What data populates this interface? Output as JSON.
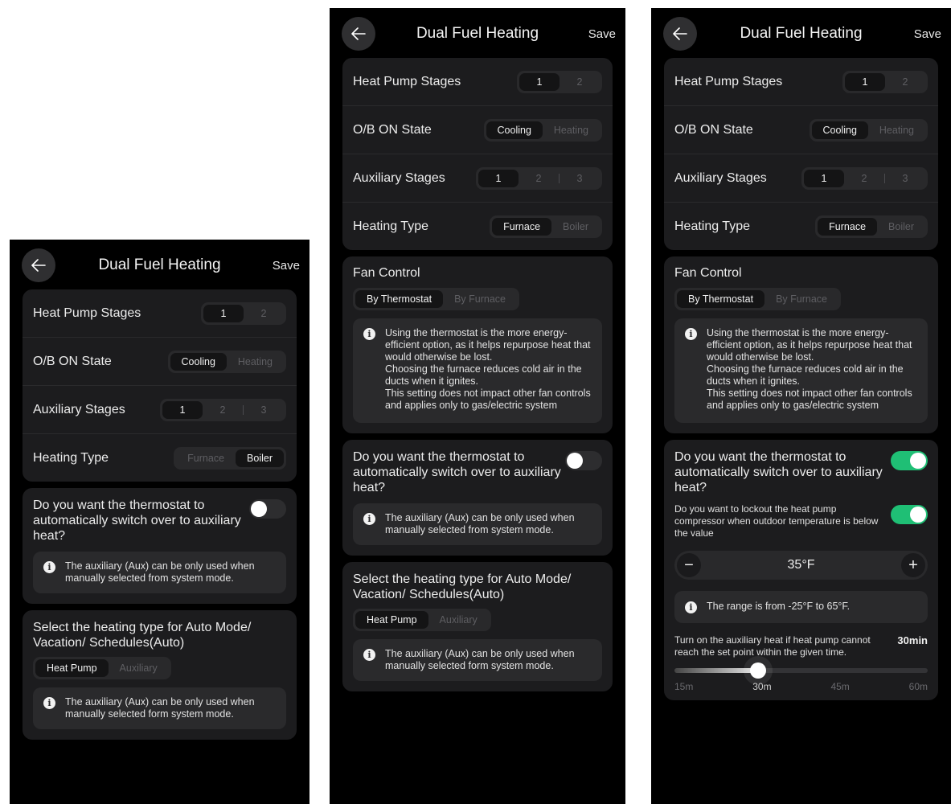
{
  "header": {
    "title": "Dual Fuel Heating",
    "save_label": "Save"
  },
  "settings": {
    "heat_pump_stages": {
      "label": "Heat Pump Stages",
      "options": [
        "1",
        "2"
      ]
    },
    "ob_on_state": {
      "label": "O/B ON State",
      "options": [
        "Cooling",
        "Heating"
      ]
    },
    "auxiliary_stages": {
      "label": "Auxiliary Stages",
      "options": [
        "1",
        "2",
        "3"
      ]
    },
    "heating_type": {
      "label": "Heating Type",
      "options": [
        "Furnace",
        "Boiler"
      ]
    }
  },
  "fan_control": {
    "title": "Fan Control",
    "options": [
      "By Thermostat",
      "By Furnace"
    ],
    "info": "Using the thermostat is the more energy-efficient option, as it helps repurpose heat that would otherwise be lost.\nChoosing the furnace reduces cold air in the ducts when it ignites.\nThis setting does not impact other fan controls and applies only to gas/electric system"
  },
  "auto_switch": {
    "question": "Do you want the thermostat to automatically switch over to auxiliary heat?",
    "info": "The auxiliary (Aux) can be only used when manually selected from system mode."
  },
  "auto_mode": {
    "title": "Select the heating type for Auto Mode/ Vacation/ Schedules(Auto)",
    "options": [
      "Heat Pump",
      "Auxiliary"
    ],
    "info": "The auxiliary (Aux) can be only used when manually selected form system mode."
  },
  "lockout": {
    "question": "Do you want to lockout the heat pump compressor when outdoor temperature is below the value",
    "value": "35°F",
    "range_info": "The range is from -25°F to 65°F."
  },
  "aux_timer": {
    "question": "Turn on the auxiliary heat if heat pump cannot reach the set point within the given time.",
    "value": "30min",
    "ticks": [
      "15m",
      "30m",
      "45m",
      "60m"
    ],
    "level": 0.33
  },
  "icons": {
    "back": "arrow-left-icon",
    "info": "info-icon",
    "minus": "minus-icon",
    "plus": "plus-icon"
  }
}
